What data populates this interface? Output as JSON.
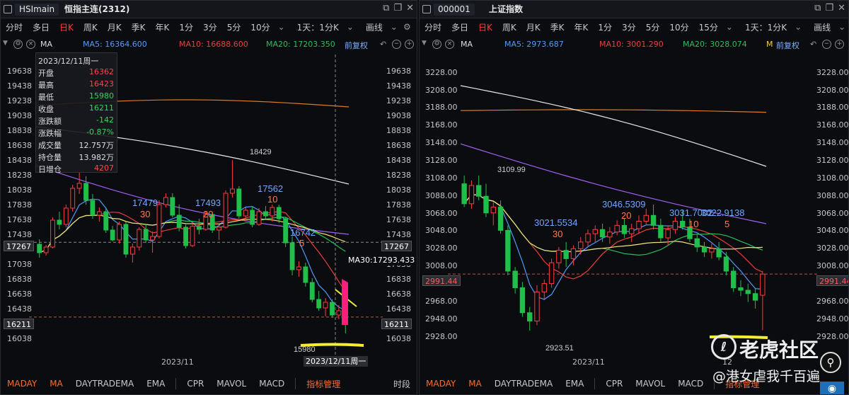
{
  "left": {
    "symbol_code": "HSImain",
    "symbol_name": "恒指主连(2312)",
    "periods": [
      "分时",
      "多日",
      "日K",
      "周K",
      "月K",
      "季K",
      "年K",
      "1分",
      "3分",
      "5分",
      "10分",
      "1天：1分K"
    ],
    "active_period": "日K",
    "draw_label": "画线",
    "ind_type": "MA",
    "ma5": "MA5: 16364.600",
    "ma10": "MA10: 16688.600",
    "ma20": "MA20: 17203.350",
    "adjust": "前复权",
    "y_ticks": [
      "19638",
      "19438",
      "19238",
      "19038",
      "18838",
      "18638",
      "18438",
      "18238",
      "18038",
      "17838",
      "17638",
      "17438",
      "17238",
      "17038",
      "16838",
      "16638",
      "16438",
      "16238",
      "16038"
    ],
    "tooltip": {
      "date": "2023/12/11周一",
      "rows": [
        {
          "label": "开盘",
          "value": "16362",
          "color": "#ff4545"
        },
        {
          "label": "最高",
          "value": "16423",
          "color": "#ff4545"
        },
        {
          "label": "最低",
          "value": "15980",
          "color": "#2fd65a"
        },
        {
          "label": "收盘",
          "value": "16211",
          "color": "#2fd65a"
        },
        {
          "label": "涨跌额",
          "value": "-142",
          "color": "#2fd65a"
        },
        {
          "label": "涨跌幅",
          "value": "-0.87%",
          "color": "#2fd65a"
        },
        {
          "label": "成交量",
          "value": "12.757万",
          "color": "#dddddd"
        },
        {
          "label": "持仓量",
          "value": "13.982万",
          "color": "#dddddd"
        },
        {
          "label": "日增仓",
          "value": "4207",
          "color": "#ff4545"
        }
      ]
    },
    "annotations": [
      "18429",
      "17479",
      "30",
      "17493",
      "20",
      "17562",
      "10",
      "16742",
      "5",
      "15980"
    ],
    "crosshair_price": "17267",
    "last_price": "16211",
    "ma30_label": "MA30:17293.433",
    "x_label": "2023/11",
    "crosshair_date": "2023/12/11周一",
    "bottom_tabs": [
      "MADAY",
      "MA",
      "DAYTRADEMA",
      "EMA",
      "CPR",
      "MAVOL",
      "MACD"
    ],
    "indicator_mgmt": "指标管理",
    "time_share": "时段"
  },
  "right": {
    "symbol_code": "000001",
    "symbol_name": "上证指数",
    "periods": [
      "分时",
      "多日",
      "日K",
      "周K",
      "月K",
      "季K",
      "年K",
      "1分",
      "3分",
      "5分",
      "10分",
      "15分",
      "1天：1分K"
    ],
    "active_period": "日K",
    "draw_label": "画线",
    "ind_type": "MA",
    "ma5": "MA5: 2973.687",
    "ma10": "MA10: 3001.290",
    "ma20": "MA20: 3028.074",
    "adjust": "前复权",
    "y_ticks": [
      "3228.00",
      "3208.00",
      "3188.00",
      "3168.00",
      "3148.00",
      "3128.00",
      "3108.00",
      "3088.00",
      "3068.00",
      "3048.00",
      "3028.00",
      "3008.00",
      "2988.00",
      "2968.00",
      "2948.00",
      "2928.00"
    ],
    "annotations": [
      "3109.99",
      "3021.5534",
      "30",
      "3046.5309",
      "20",
      "3031.7002",
      "10",
      "3022.9138",
      "5",
      "2923.51"
    ],
    "last_price": "2991.44",
    "x_labels": [
      "2023/11",
      "12"
    ],
    "bottom_tabs": [
      "MADAY",
      "MA",
      "DAYTRADEMA",
      "EMA",
      "CPR",
      "MAVOL",
      "MACD"
    ],
    "indicator_mgmt": "指标管理"
  },
  "watermark": {
    "brand": "老虎社区",
    "user": "@港女虐我千百遍"
  },
  "colors": {
    "up": "#ff3b3b",
    "down": "#1fbf4a",
    "ma5": "#4e9bff",
    "ma10": "#e8403a",
    "ma20": "#22c05a",
    "ma30": "#f3e27a",
    "ma60": "#a060f0",
    "ma120": "#e8e8e8",
    "ma250": "#e07a20"
  },
  "chart_data": [
    {
      "type": "candlestick",
      "title": "恒指主连(2312)",
      "xlabel": "2023/11",
      "ylim": [
        15900,
        19700
      ],
      "last_candle": {
        "date": "2023/12/11",
        "open": 16362,
        "high": 16423,
        "low": 15980,
        "close": 16211
      },
      "ma": {
        "MA5": 16364.6,
        "MA10": 16688.6,
        "MA20": 17203.35,
        "MA30": 17293.433
      },
      "series": [
        {
          "name": "HSImain",
          "values": [
            [
              17240,
              17310,
              17050,
              17120
            ],
            [
              17120,
              17230,
              17080,
              17200
            ],
            [
              17200,
              17620,
              17180,
              17580
            ],
            [
              17580,
              17700,
              17450,
              17520
            ],
            [
              17520,
              17800,
              17480,
              17750
            ],
            [
              17750,
              18080,
              17700,
              18030
            ],
            [
              18030,
              18250,
              17950,
              18100
            ],
            [
              18100,
              18200,
              17800,
              17860
            ],
            [
              17860,
              17950,
              17600,
              17650
            ],
            [
              17650,
              17760,
              17560,
              17700
            ],
            [
              17700,
              17760,
              17400,
              17440
            ],
            [
              17440,
              17500,
              17280,
              17300
            ],
            [
              17300,
              17560,
              17250,
              17520
            ],
            [
              17520,
              17560,
              17050,
              17100
            ],
            [
              17100,
              17250,
              16980,
              17200
            ],
            [
              17200,
              17480,
              17150,
              17450
            ],
            [
              17450,
              17520,
              17260,
              17300
            ],
            [
              17300,
              17420,
              17120,
              17350
            ],
            [
              17350,
              17860,
              17320,
              17800
            ],
            [
              17800,
              17960,
              17760,
              17900
            ],
            [
              17900,
              17960,
              17620,
              17650
            ],
            [
              17650,
              17800,
              17420,
              17480
            ],
            [
              17480,
              17520,
              17180,
              17220
            ],
            [
              17220,
              17560,
              17200,
              17493
            ],
            [
              17493,
              17600,
              17380,
              17450
            ],
            [
              17450,
              17700,
              17430,
              17660
            ],
            [
              17660,
              17700,
              17400,
              17440
            ],
            [
              17440,
              17520,
              17300,
              17480
            ],
            [
              17480,
              18000,
              17460,
              17960
            ],
            [
              17960,
              18429,
              17900,
              18020
            ],
            [
              18020,
              18060,
              17600,
              17640
            ],
            [
              17640,
              17760,
              17560,
              17720
            ],
            [
              17720,
              17780,
              17480,
              17520
            ],
            [
              17520,
              17750,
              17500,
              17700
            ],
            [
              17700,
              17780,
              17600,
              17640
            ],
            [
              17640,
              17800,
              17560,
              17760
            ],
            [
              17760,
              17800,
              17540,
              17600
            ],
            [
              17600,
              17620,
              17200,
              17260
            ],
            [
              17260,
              17350,
              16800,
              16880
            ],
            [
              16880,
              17000,
              16780,
              16920
            ],
            [
              16920,
              16980,
              16640,
              16700
            ],
            [
              16700,
              16760,
              16420,
              16460
            ],
            [
              16460,
              16580,
              16300,
              16340
            ],
            [
              16340,
              16480,
              16220,
              16420
            ],
            [
              16420,
              16460,
              16200,
              16240
            ],
            [
              16240,
              16380,
              16180,
              16300
            ],
            [
              16362,
              16423,
              15980,
              16211
            ]
          ]
        }
      ]
    },
    {
      "type": "candlestick",
      "title": "上证指数",
      "xlabel": "2023/11",
      "ylim": [
        2915,
        3235
      ],
      "last_candle": {
        "close": 2991.44
      },
      "ma": {
        "MA5": 2973.687,
        "MA10": 3001.29,
        "MA20": 3028.074
      },
      "series": [
        {
          "name": "000001",
          "values": [
            [
              3100,
              3110,
              3072,
              3076
            ],
            [
              3076,
              3104,
              3070,
              3098
            ],
            [
              3098,
              3109.99,
              3080,
              3085
            ],
            [
              3085,
              3100,
              3060,
              3065
            ],
            [
              3065,
              3078,
              3050,
              3072
            ],
            [
              3072,
              3080,
              3040,
              3044
            ],
            [
              3044,
              3050,
              2990,
              2995
            ],
            [
              2995,
              3000,
              2968,
              2975
            ],
            [
              2975,
              2982,
              2940,
              2945
            ],
            [
              2945,
              2952,
              2923.51,
              2935
            ],
            [
              2935,
              2978,
              2930,
              2970
            ],
            [
              2970,
              2985,
              2960,
              2980
            ],
            [
              2980,
              3010,
              2975,
              3005
            ],
            [
              3005,
              3024,
              2998,
              3020
            ],
            [
              3020,
              3030,
              3000,
              3010
            ],
            [
              3010,
              3026,
              3002,
              3022
            ],
            [
              3022,
              3036,
              3015,
              3030
            ],
            [
              3030,
              3045,
              3025,
              3040
            ],
            [
              3040,
              3050,
              3030,
              3045
            ],
            [
              3045,
              3052,
              3030,
              3036
            ],
            [
              3036,
              3048,
              3028,
              3042
            ],
            [
              3042,
              3056,
              3038,
              3050
            ],
            [
              3050,
              3058,
              3035,
              3040
            ],
            [
              3040,
              3052,
              3030,
              3046
            ],
            [
              3046,
              3062,
              3040,
              3055
            ],
            [
              3055,
              3070,
              3050,
              3062
            ],
            [
              3062,
              3075,
              3045,
              3050
            ],
            [
              3050,
              3058,
              3030,
              3035
            ],
            [
              3035,
              3050,
              3026,
              3045
            ],
            [
              3045,
              3060,
              3040,
              3055
            ],
            [
              3055,
              3068,
              3045,
              3048
            ],
            [
              3048,
              3058,
              3030,
              3034
            ],
            [
              3034,
              3040,
              3018,
              3024
            ],
            [
              3024,
              3030,
              3012,
              3018
            ],
            [
              3018,
              3028,
              3010,
              3022
            ],
            [
              3022,
              3030,
              3008,
              3012
            ],
            [
              3012,
              3018,
              2990,
              2995
            ],
            [
              2995,
              3000,
              2970,
              2975
            ],
            [
              2975,
              2984,
              2965,
              2972
            ],
            [
              2972,
              2980,
              2958,
              2968
            ],
            [
              2968,
              2975,
              2950,
              2960
            ],
            [
              2966,
              2995,
              2924,
              2991.44
            ]
          ]
        }
      ]
    }
  ]
}
